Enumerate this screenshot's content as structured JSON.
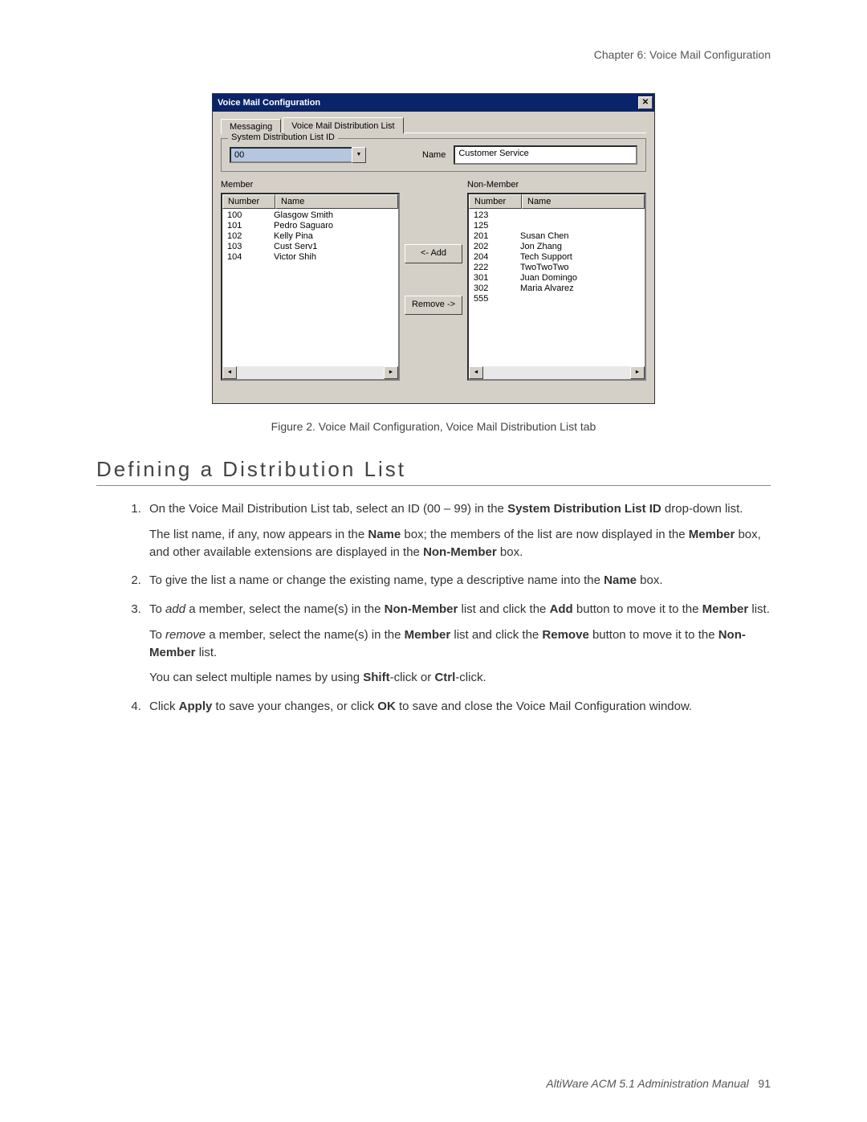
{
  "page": {
    "header": "Chapter 6:  Voice Mail Configuration",
    "footer_doc": "AltiWare ACM 5.1 Administration Manual",
    "footer_page": "91"
  },
  "dialog": {
    "title": "Voice Mail Configuration",
    "close_glyph": "✕",
    "tabs": {
      "messaging": "Messaging",
      "dist_list": "Voice Mail Distribution List"
    },
    "fieldset_legend": "System Distribution List ID",
    "dropdown_value": "00",
    "dropdown_arrow_glyph": "▼",
    "name_label": "Name",
    "name_value": "Customer Service",
    "member_label": "Member",
    "nonmember_label": "Non-Member",
    "col_number": "Number",
    "col_name": "Name",
    "add_btn": "<- Add",
    "remove_btn": "Remove ->",
    "scroll_left_glyph": "◄",
    "scroll_right_glyph": "►",
    "members": [
      {
        "number": "100",
        "name": "Glasgow Smith"
      },
      {
        "number": "101",
        "name": "Pedro Saguaro"
      },
      {
        "number": "102",
        "name": "Kelly Pina"
      },
      {
        "number": "103",
        "name": "Cust Serv1"
      },
      {
        "number": "104",
        "name": "Victor Shih"
      }
    ],
    "nonmembers": [
      {
        "number": "123",
        "name": ""
      },
      {
        "number": "125",
        "name": ""
      },
      {
        "number": "201",
        "name": "Susan Chen"
      },
      {
        "number": "202",
        "name": "Jon Zhang"
      },
      {
        "number": "204",
        "name": "Tech Support"
      },
      {
        "number": "222",
        "name": "TwoTwoTwo"
      },
      {
        "number": "301",
        "name": "Juan Domingo"
      },
      {
        "number": "302",
        "name": "Maria Alvarez"
      },
      {
        "number": "555",
        "name": ""
      }
    ]
  },
  "caption": "Figure 2.   Voice Mail Configuration, Voice Mail Distribution List tab",
  "section_title": "Defining a Distribution List",
  "instructions": {
    "step1_a": "On the Voice Mail Distribution List tab, select an ID (00 – 99) in the ",
    "step1_b": "System Distribution List ID",
    "step1_c": " drop-down list.",
    "step1_p_a": "The list name, if any, now appears in the ",
    "step1_p_name": "Name",
    "step1_p_b": " box; the members of the list are now displayed in the ",
    "step1_p_member": "Member",
    "step1_p_c": " box, and other available extensions are displayed in the ",
    "step1_p_nonmember": "Non-Member",
    "step1_p_d": " box.",
    "step2_a": "To give the list a name or change the existing name, type a descriptive name into the ",
    "step2_name": "Name",
    "step2_b": " box.",
    "step3_a": "To ",
    "step3_add_i": "add",
    "step3_b": " a member, select the name(s) in the ",
    "step3_nonmember": "Non-Member",
    "step3_c": " list and click the ",
    "step3_addbtn": "Add",
    "step3_d": " button to move it to the ",
    "step3_member": "Member",
    "step3_e": " list.",
    "step3_p_a": "To ",
    "step3_p_remove_i": "remove",
    "step3_p_b": " a member, select the name(s) in the ",
    "step3_p_member": "Member",
    "step3_p_c": " list and click the ",
    "step3_p_removebtn": "Remove",
    "step3_p_d": " button to move it to the ",
    "step3_p_nonmember": "Non-Member",
    "step3_p_e": " list.",
    "step3_p2_a": "You can select multiple names by using ",
    "step3_p2_shift": "Shift",
    "step3_p2_b": "-click or ",
    "step3_p2_ctrl": "Ctrl",
    "step3_p2_c": "-click.",
    "step4_a": "Click ",
    "step4_apply": "Apply",
    "step4_b": " to save your changes, or click ",
    "step4_ok": "OK",
    "step4_c": " to save and close the Voice Mail Configuration window."
  }
}
